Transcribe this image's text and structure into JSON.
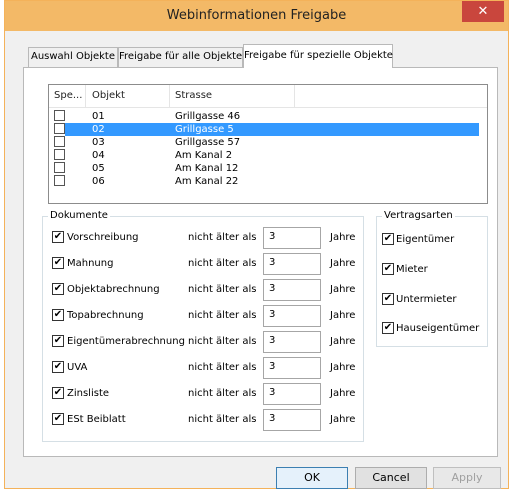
{
  "window": {
    "title": "Webinformationen Freigabe",
    "close_glyph": "✕"
  },
  "tabs": [
    {
      "label": "Auswahl Objekte"
    },
    {
      "label": "Freigabe für alle Objekte"
    },
    {
      "label": "Freigabe für spezielle Objekte",
      "active": true
    }
  ],
  "objects_list": {
    "columns": [
      "Spe...",
      "Objekt",
      "Strasse"
    ],
    "rows": [
      {
        "objekt": "01",
        "strasse": "Grillgasse 46",
        "checked": false
      },
      {
        "objekt": "02",
        "strasse": "Grillgasse 5",
        "checked": false,
        "selected": true
      },
      {
        "objekt": "03",
        "strasse": "Grillgasse 57",
        "checked": false
      },
      {
        "objekt": "04",
        "strasse": "Am Kanal 2",
        "checked": false
      },
      {
        "objekt": "05",
        "strasse": "Am Kanal 12",
        "checked": false
      },
      {
        "objekt": "06",
        "strasse": "Am Kanal 22",
        "checked": false
      }
    ]
  },
  "dokumente": {
    "title": "Dokumente",
    "age_label": "nicht älter als",
    "unit": "Jahre",
    "items": [
      {
        "label": "Vorschreibung",
        "checked": true,
        "years": "3"
      },
      {
        "label": "Mahnung",
        "checked": true,
        "years": "3"
      },
      {
        "label": "Objektabrechnung",
        "checked": true,
        "years": "3"
      },
      {
        "label": "Topabrechnung",
        "checked": true,
        "years": "3"
      },
      {
        "label": "Eigentümerabrechnung",
        "checked": true,
        "years": "3"
      },
      {
        "label": "UVA",
        "checked": true,
        "years": "3"
      },
      {
        "label": "Zinsliste",
        "checked": true,
        "years": "3"
      },
      {
        "label": "ESt Beiblatt",
        "checked": true,
        "years": "3"
      }
    ]
  },
  "vertragsarten": {
    "title": "Vertragsarten",
    "items": [
      {
        "label": "Eigentümer",
        "checked": true
      },
      {
        "label": "Mieter",
        "checked": true
      },
      {
        "label": "Untermieter",
        "checked": true
      },
      {
        "label": "Hauseigentümer",
        "checked": true
      }
    ]
  },
  "buttons": {
    "ok": "OK",
    "cancel": "Cancel",
    "apply": "Apply"
  }
}
